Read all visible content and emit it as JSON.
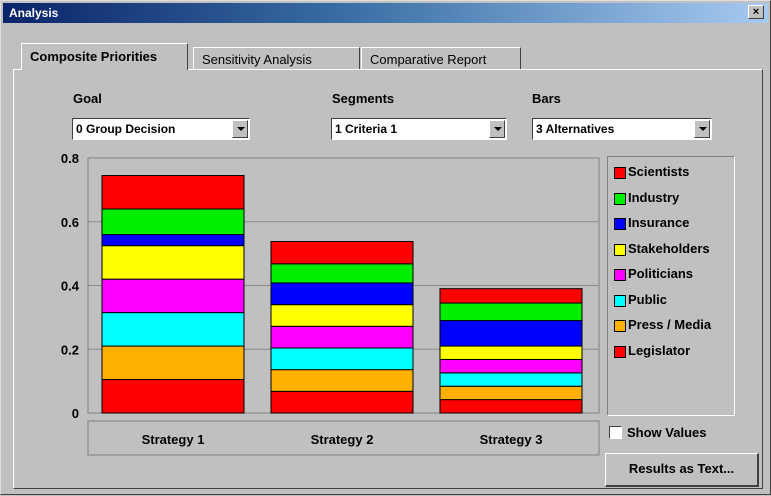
{
  "window": {
    "title": "Analysis",
    "close_label": "×"
  },
  "tabs": [
    {
      "label": "Composite Priorities",
      "active": true
    },
    {
      "label": "Sensitivity Analysis",
      "active": false
    },
    {
      "label": "Comparative Report",
      "active": false
    }
  ],
  "controls": {
    "goal_label": "Goal",
    "goal_value": "0 Group Decision",
    "segments_label": "Segments",
    "segments_value": "1 Criteria 1",
    "bars_label": "Bars",
    "bars_value": "3 Alternatives"
  },
  "chart_data": {
    "type": "bar",
    "stacked": true,
    "categories": [
      "Strategy 1",
      "Strategy 2",
      "Strategy 3"
    ],
    "ylim": [
      0,
      0.8
    ],
    "yticks": [
      "0",
      "0.2",
      "0.4",
      "0.6",
      "0.8"
    ],
    "grid": true,
    "legend_position": "right",
    "series": [
      {
        "name": "Legislator",
        "color": "#ff0000",
        "values": [
          0.105,
          0.068,
          0.042
        ]
      },
      {
        "name": "Press / Media",
        "color": "#ffb000",
        "values": [
          0.105,
          0.068,
          0.042
        ]
      },
      {
        "name": "Public",
        "color": "#00ffff",
        "values": [
          0.105,
          0.068,
          0.042
        ]
      },
      {
        "name": "Politicians",
        "color": "#ff00ff",
        "values": [
          0.105,
          0.068,
          0.042
        ]
      },
      {
        "name": "Stakeholders",
        "color": "#ffff00",
        "values": [
          0.105,
          0.068,
          0.042
        ]
      },
      {
        "name": "Insurance",
        "color": "#0000ff",
        "values": [
          0.035,
          0.068,
          0.08
        ]
      },
      {
        "name": "Industry",
        "color": "#00ee00",
        "values": [
          0.08,
          0.06,
          0.055
        ]
      },
      {
        "name": "Scientists",
        "color": "#ff0000",
        "values": [
          0.105,
          0.07,
          0.045
        ]
      }
    ]
  },
  "legend": {
    "items": [
      {
        "label": "Scientists",
        "color": "#ff0000"
      },
      {
        "label": "Industry",
        "color": "#00ee00"
      },
      {
        "label": "Insurance",
        "color": "#0000ff"
      },
      {
        "label": "Stakeholders",
        "color": "#ffff00"
      },
      {
        "label": "Politicians",
        "color": "#ff00ff"
      },
      {
        "label": "Public",
        "color": "#00ffff"
      },
      {
        "label": "Press / Media",
        "color": "#ffb000"
      },
      {
        "label": "Legislator",
        "color": "#ff0000"
      }
    ]
  },
  "options": {
    "show_values_label": "Show Values",
    "show_values_checked": false
  },
  "buttons": {
    "results_text_label": "Results as Text..."
  }
}
